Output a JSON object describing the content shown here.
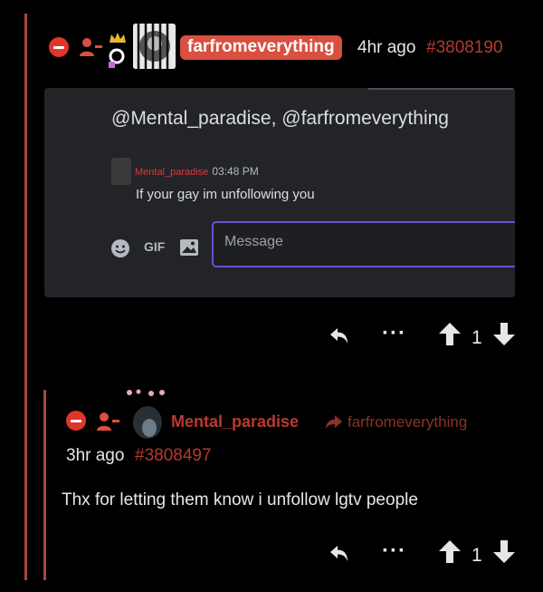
{
  "post": {
    "username": "farfromeverything",
    "time": "4hr ago",
    "id": "#3808190",
    "embed": {
      "title": "@Mental_paradise, @farfromeverything",
      "author": "Mental_paradise",
      "time": "03:48 PM",
      "message": "If your gay im unfollowing you",
      "gif_label": "GIF",
      "input_placeholder": "Message"
    },
    "score": "1"
  },
  "reply": {
    "username": "Mental_paradise",
    "parent": "farfromeverything",
    "time": "3hr ago",
    "id": "#3808497",
    "text": "Thx for letting them know i unfollow lgtv people",
    "score": "1"
  },
  "colors": {
    "accent": "#d94f40",
    "link": "#b63a30",
    "background": "#000000"
  },
  "icons": [
    "collapse-icon",
    "user-minus-icon",
    "crown-icon",
    "avatar",
    "reply-icon",
    "more-icon",
    "upvote-icon",
    "downvote-icon",
    "share-arrow-icon",
    "emoji-icon",
    "image-icon"
  ]
}
